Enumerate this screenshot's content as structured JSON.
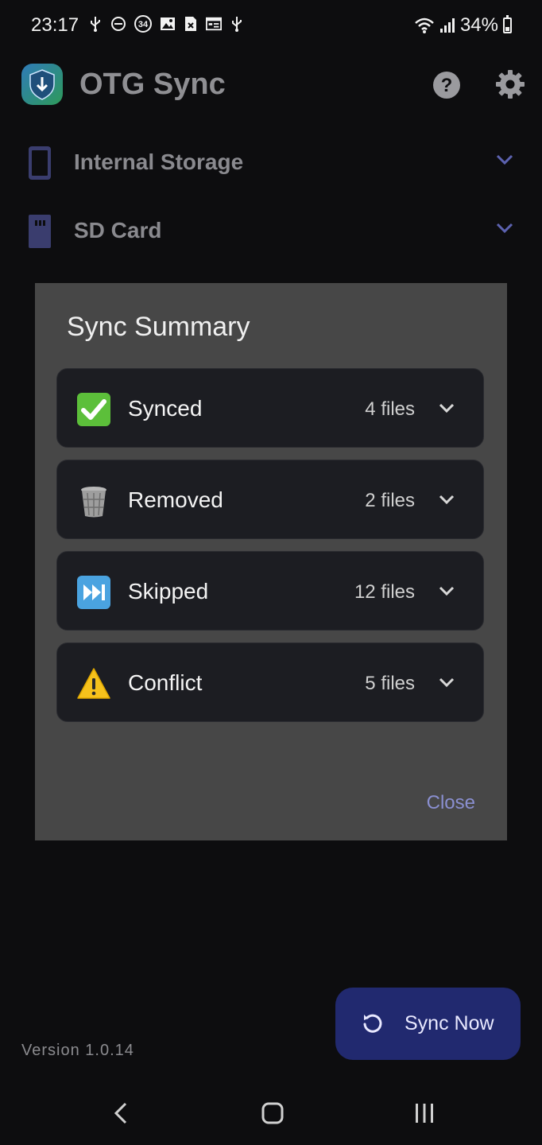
{
  "status_bar": {
    "time": "23:17",
    "notification_badge": "34",
    "battery": "34%",
    "battery_fraction": 0.34
  },
  "app": {
    "title": "OTG Sync"
  },
  "storage": [
    {
      "label": "Internal Storage",
      "icon": "phone-icon"
    },
    {
      "label": "SD Card",
      "icon": "sd-card-icon"
    }
  ],
  "dialog": {
    "title": "Sync Summary",
    "items": [
      {
        "label": "Synced",
        "count": "4 files",
        "icon": "check-mark-emoji-icon"
      },
      {
        "label": "Removed",
        "count": "2 files",
        "icon": "trash-can-emoji-icon"
      },
      {
        "label": "Skipped",
        "count": "12 files",
        "icon": "fast-forward-emoji-icon"
      },
      {
        "label": "Conflict",
        "count": "5 files",
        "icon": "warning-emoji-icon"
      }
    ],
    "close_label": "Close"
  },
  "footer": {
    "version": "Version 1.0.14",
    "sync_button_label": "Sync Now"
  },
  "colors": {
    "background": "#0d0d0f",
    "dialog": "#474747",
    "card": "#1c1d22",
    "accent": "#8a8fd0",
    "fab": "#21296f"
  }
}
